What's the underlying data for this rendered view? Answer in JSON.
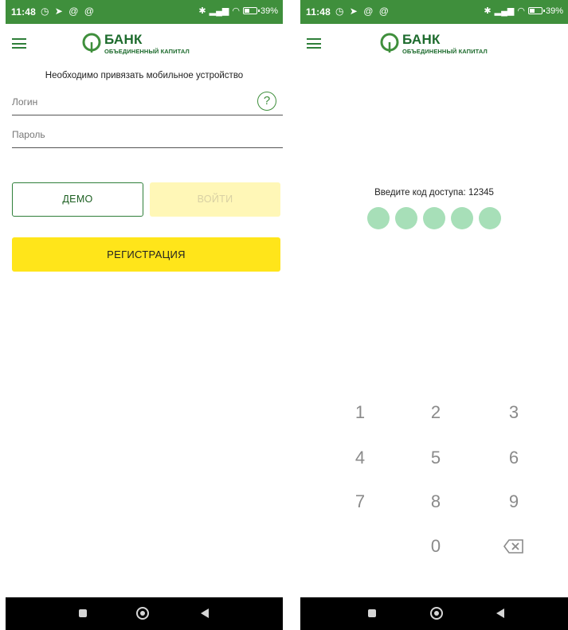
{
  "status": {
    "time": "11:48",
    "battery": "39",
    "battery_level": 0.39
  },
  "brand": {
    "name": "БАНК",
    "subtitle": "ОБЪЕДИНЕННЫЙ КАПИТАЛ",
    "color": "#1d6b2d"
  },
  "login_screen": {
    "notice": "Необходимо привязать мобильное устройство",
    "login_placeholder": "Логин",
    "password_placeholder": "Пароль",
    "help_symbol": "?",
    "demo_label": "ДЕМО",
    "login_label": "ВОЙТИ",
    "register_label": "РЕГИСТРАЦИЯ"
  },
  "pin_screen": {
    "prompt": "Введите код доступа: 12345",
    "pin_length": 5,
    "keys": [
      "1",
      "2",
      "3",
      "4",
      "5",
      "6",
      "7",
      "8",
      "9",
      "0"
    ]
  },
  "colors": {
    "statusbar": "#3f8f3c",
    "accent_green": "#2f7f3a",
    "register_yellow": "#ffe51a",
    "login_disabled": "#fff7b7",
    "pin_dot": "#a7dfb8"
  },
  "icons": {
    "menu": "hamburger-icon",
    "help": "question-icon",
    "backspace": "backspace-icon",
    "nav_recent": "square-icon",
    "nav_home": "circle-icon",
    "nav_back": "triangle-icon"
  }
}
